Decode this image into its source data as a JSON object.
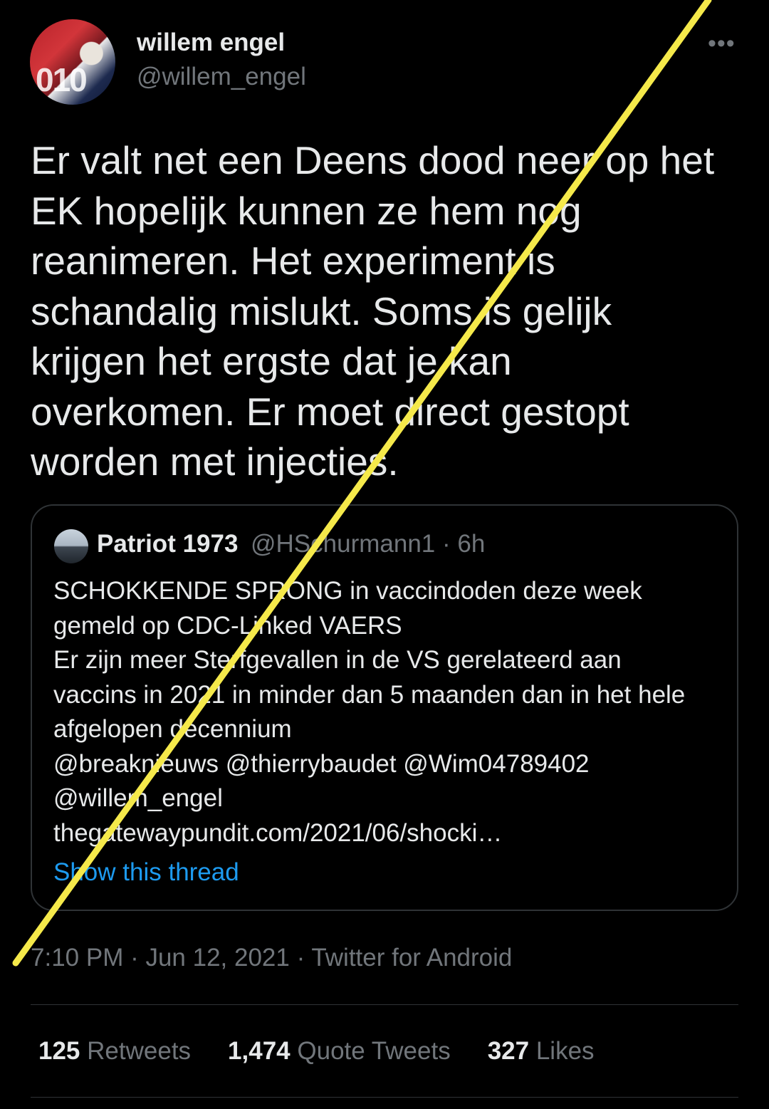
{
  "author": {
    "name": "willem engel",
    "handle": "@willem_engel",
    "avatar_text": "010"
  },
  "more_label": "•••",
  "tweet_text": "Er valt net een Deens dood neer op het\nEK hopelijk kunnen ze hem nog\nreanimeren. Het experiment is\nschandalig mislukt. Soms is gelijk\nkrijgen het ergste dat je kan\noverkomen. Er moet direct gestopt\nworden met injecties.",
  "quoted_tweet": {
    "name": "Patriot 1973",
    "handle_time": "@HSchurmann1 · 6h",
    "text": "SCHOKKENDE SPRONG in vaccindoden deze week\ngemeld op CDC-Linked VAERS\nEr zijn meer Sterfgevallen in de VS gerelateerd aan\nvaccins in 2021 in minder dan 5 maanden dan in het hele\nafgelopen decennium\n@breaknieuws @thierrybaudet @Wim04789402\n@willem_engel\nthegatewaypundit.com/2021/06/shocki…",
    "show_thread_label": "Show this thread"
  },
  "meta": "7:10 PM · Jun 12, 2021 · Twitter for Android",
  "stats": {
    "retweets_count": "125",
    "retweets_label": "Retweets",
    "quotes_count": "1,474",
    "quotes_label": "Quote Tweets",
    "likes_count": "327",
    "likes_label": "Likes"
  },
  "colors": {
    "background": "#000000",
    "text": "#e7e9ea",
    "secondary": "#71767b",
    "link": "#1d9bf0",
    "slash": "#f5e94a"
  }
}
